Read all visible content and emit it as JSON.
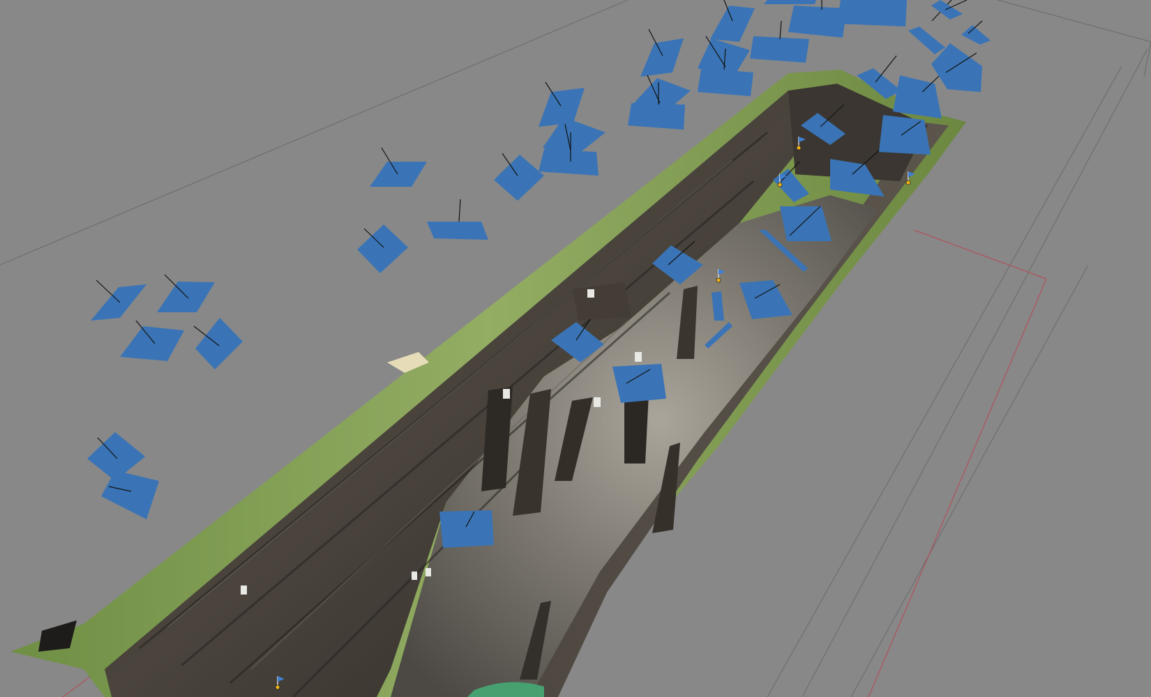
{
  "viewport": {
    "background_color": "#888888",
    "grid_line_color": "#6e6e6e",
    "bounding_box_color": "#b0525a"
  },
  "model": {
    "type": "photogrammetry-trench",
    "turf_color": "#7d9a4c",
    "soil_color": "#3f3a35",
    "floor_color": "#6f6c66"
  },
  "cameras": {
    "color": "#3a74b6",
    "count": 42
  },
  "markers": {
    "icon": "flag-marker-icon",
    "flag_color": "#3f7fd1",
    "pin_color": "#f2b418",
    "count": 5
  }
}
